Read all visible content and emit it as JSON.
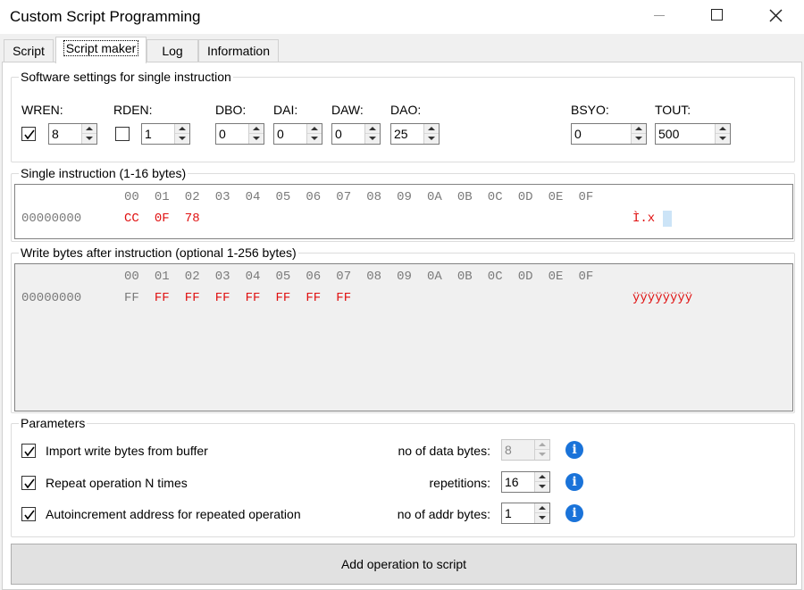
{
  "window": {
    "title": "Custom Script Programming"
  },
  "tabs": [
    {
      "label": "Script",
      "active": false
    },
    {
      "label": "Script maker",
      "active": true
    },
    {
      "label": "Log",
      "active": false
    },
    {
      "label": "Information",
      "active": false
    }
  ],
  "software_settings": {
    "title": "Software settings for single instruction",
    "wren": {
      "label": "WREN:",
      "checked": true,
      "value": "8"
    },
    "rden": {
      "label": "RDEN:",
      "checked": false,
      "value": "1"
    },
    "dbo": {
      "label": "DBO:",
      "value": "0"
    },
    "dai": {
      "label": "DAI:",
      "value": "0"
    },
    "daw": {
      "label": "DAW:",
      "value": "0"
    },
    "dao": {
      "label": "DAO:",
      "value": "25"
    },
    "bsyo": {
      "label": "BSYO:",
      "value": "0"
    },
    "tout": {
      "label": "TOUT:",
      "value": "500"
    }
  },
  "single_instruction": {
    "title": "Single instruction (1-16 bytes)",
    "columns": [
      "00",
      "01",
      "02",
      "03",
      "04",
      "05",
      "06",
      "07",
      "08",
      "09",
      "0A",
      "0B",
      "0C",
      "0D",
      "0E",
      "0F"
    ],
    "address": "00000000",
    "bytes": [
      "CC",
      "0F",
      "78"
    ],
    "ascii": "Ì.x"
  },
  "write_bytes": {
    "title": "Write bytes after instruction (optional 1-256 bytes)",
    "columns": [
      "00",
      "01",
      "02",
      "03",
      "04",
      "05",
      "06",
      "07",
      "08",
      "09",
      "0A",
      "0B",
      "0C",
      "0D",
      "0E",
      "0F"
    ],
    "address": "00000000",
    "bytes": [
      "FF",
      "FF",
      "FF",
      "FF",
      "FF",
      "FF",
      "FF",
      "FF"
    ],
    "ascii": "ÿÿÿÿÿÿÿÿ"
  },
  "parameters": {
    "title": "Parameters",
    "import_write_bytes": {
      "label": "Import write bytes from buffer",
      "checked": true
    },
    "repeat_operation": {
      "label": "Repeat operation N times",
      "checked": true
    },
    "autoincrement": {
      "label": "Autoincrement address for repeated operation",
      "checked": true
    },
    "data_bytes": {
      "label": "no of data bytes:",
      "value": "8",
      "enabled": false
    },
    "repetitions": {
      "label": "repetitions:",
      "value": "16",
      "enabled": true
    },
    "addr_bytes": {
      "label": "no of addr bytes:",
      "value": "1",
      "enabled": true
    }
  },
  "add_button": {
    "label": "Add operation to script"
  },
  "colors": {
    "hex_bytes": "#e01010",
    "hex_gray": "#7a7a7a",
    "info_icon": "#1a73d9"
  }
}
